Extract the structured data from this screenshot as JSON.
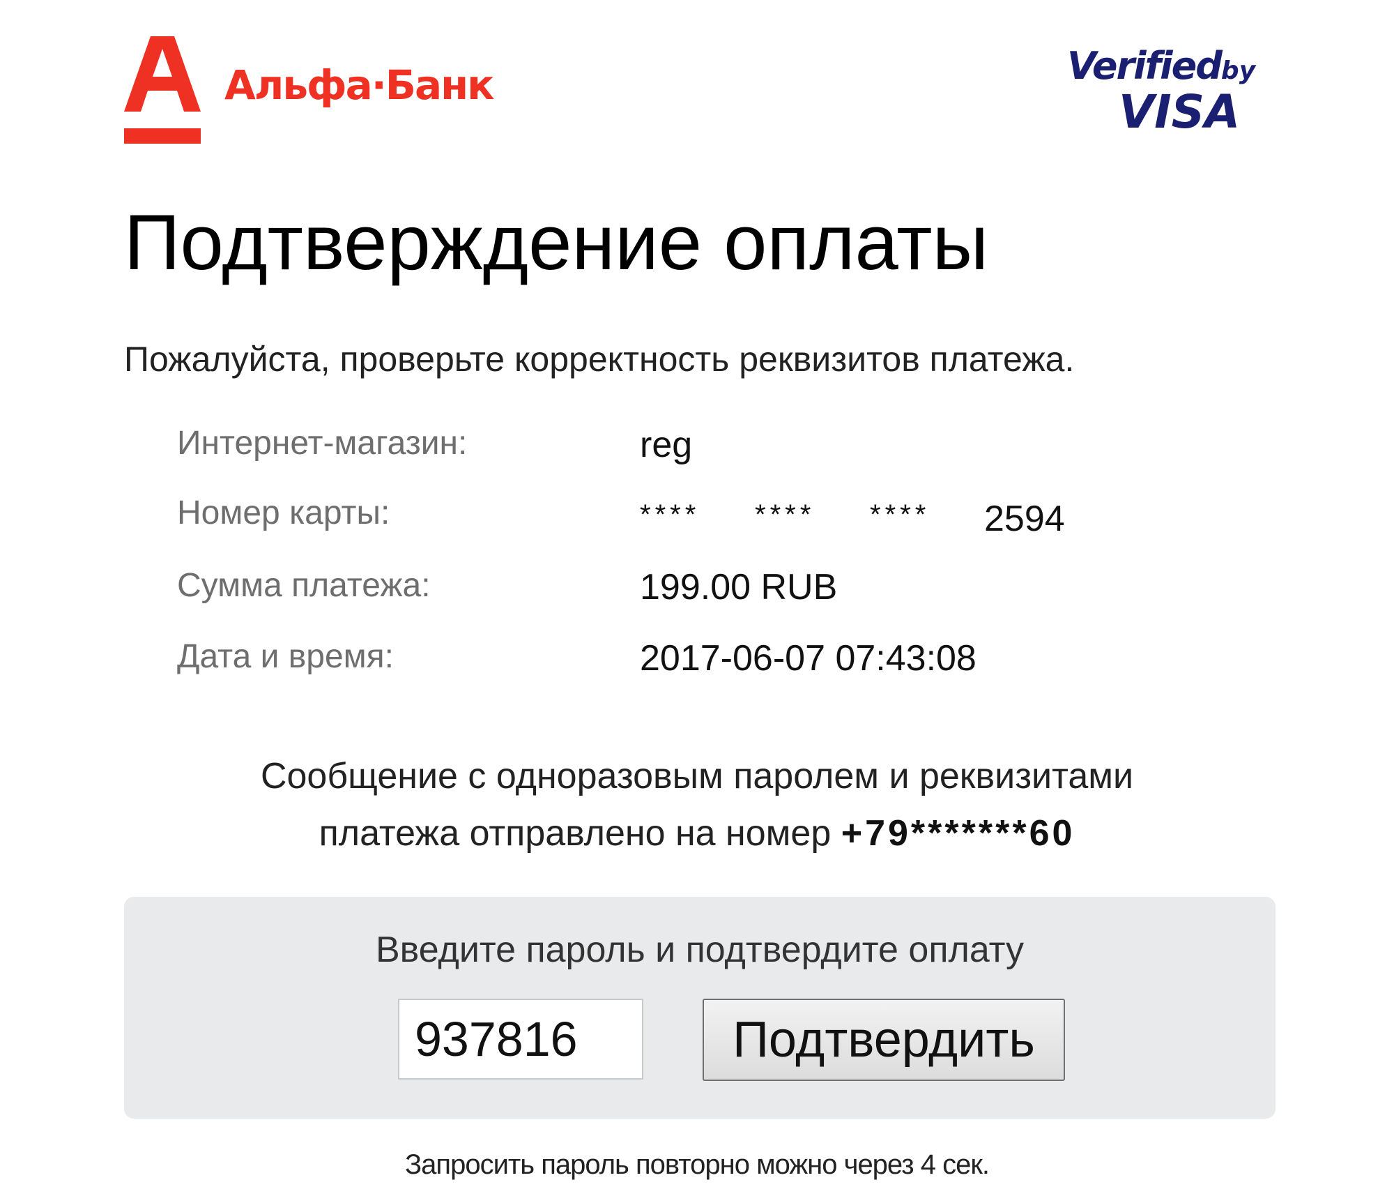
{
  "header": {
    "bank_name": "Альфа·Банк",
    "visa_verified": "Verified",
    "visa_by": "by",
    "visa_word": "VISA"
  },
  "colors": {
    "brand_red": "#ef3124",
    "visa_blue": "#1a1f71",
    "panel_bg": "#e8eaeb"
  },
  "title": "Подтверждение оплаты",
  "intro": "Пожалуйста, проверьте корректность реквизитов платежа.",
  "details": {
    "shop_label": "Интернет-магазин:",
    "shop_value": "reg",
    "card_label": "Номер карты:",
    "card_groups": [
      "****",
      "****",
      "****",
      "2594"
    ],
    "amount_label": "Сумма платежа:",
    "amount_value": "199.00 RUB",
    "date_label": "Дата и время:",
    "date_value": "2017-06-07 07:43:08"
  },
  "sms": {
    "line1": "Сообщение с одноразовым паролем и реквизитами",
    "line2_prefix": "платежа отправлено на номер",
    "phone": "+79*******60"
  },
  "form": {
    "prompt": "Введите пароль и подтвердите оплату",
    "password_value": "937816",
    "confirm_label": "Подтвердить"
  },
  "resend_note": "Запросить пароль повторно можно через 4 сек."
}
